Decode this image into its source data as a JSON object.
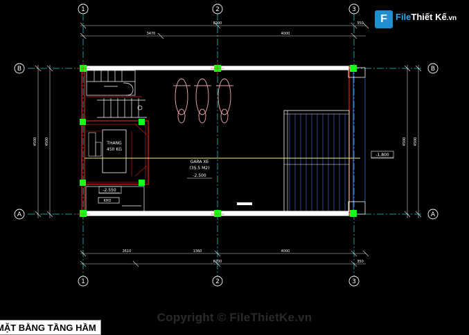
{
  "logo": {
    "mark": "F",
    "brand": "File",
    "name": "Thiết Kế",
    "domain": ".vn"
  },
  "copyright": "Copyright © FileThietKe.vn",
  "drawing_title": "MẶT BẰNG TẦNG HẦM",
  "grid_axes": {
    "vertical": [
      "1",
      "2",
      "3"
    ],
    "horizontal": [
      "B",
      "A"
    ]
  },
  "dimensions": {
    "top_total": "8200",
    "top_segments": [
      "3470",
      "4000"
    ],
    "top_edge": "350",
    "bottom_total": "8200",
    "bottom_segments": [
      "2610",
      "1360",
      "4000"
    ],
    "bottom_edge": "350",
    "left_total": "4500",
    "left_inner": "4500",
    "right_total": "4500",
    "right_inner": "4500"
  },
  "labels": {
    "elevator": "THANG",
    "elevator_capacity": "450 KG",
    "garage": "GARA XE",
    "garage_area": "(35.5 M2)",
    "level_garage": "-2.500",
    "level_left": "-2.550",
    "room_small": "KHO",
    "level_right": "-1.800"
  },
  "colors": {
    "background": "#000000",
    "wall": "#e01e1e",
    "grid_line": "#22c9c9",
    "text": "#ffffff",
    "column": "#19ff19",
    "axis_bubble": "#ffffff",
    "hatch": "#3a6cd8",
    "yellow_line": "#f5f57a",
    "brand": "#2ea8e6"
  }
}
